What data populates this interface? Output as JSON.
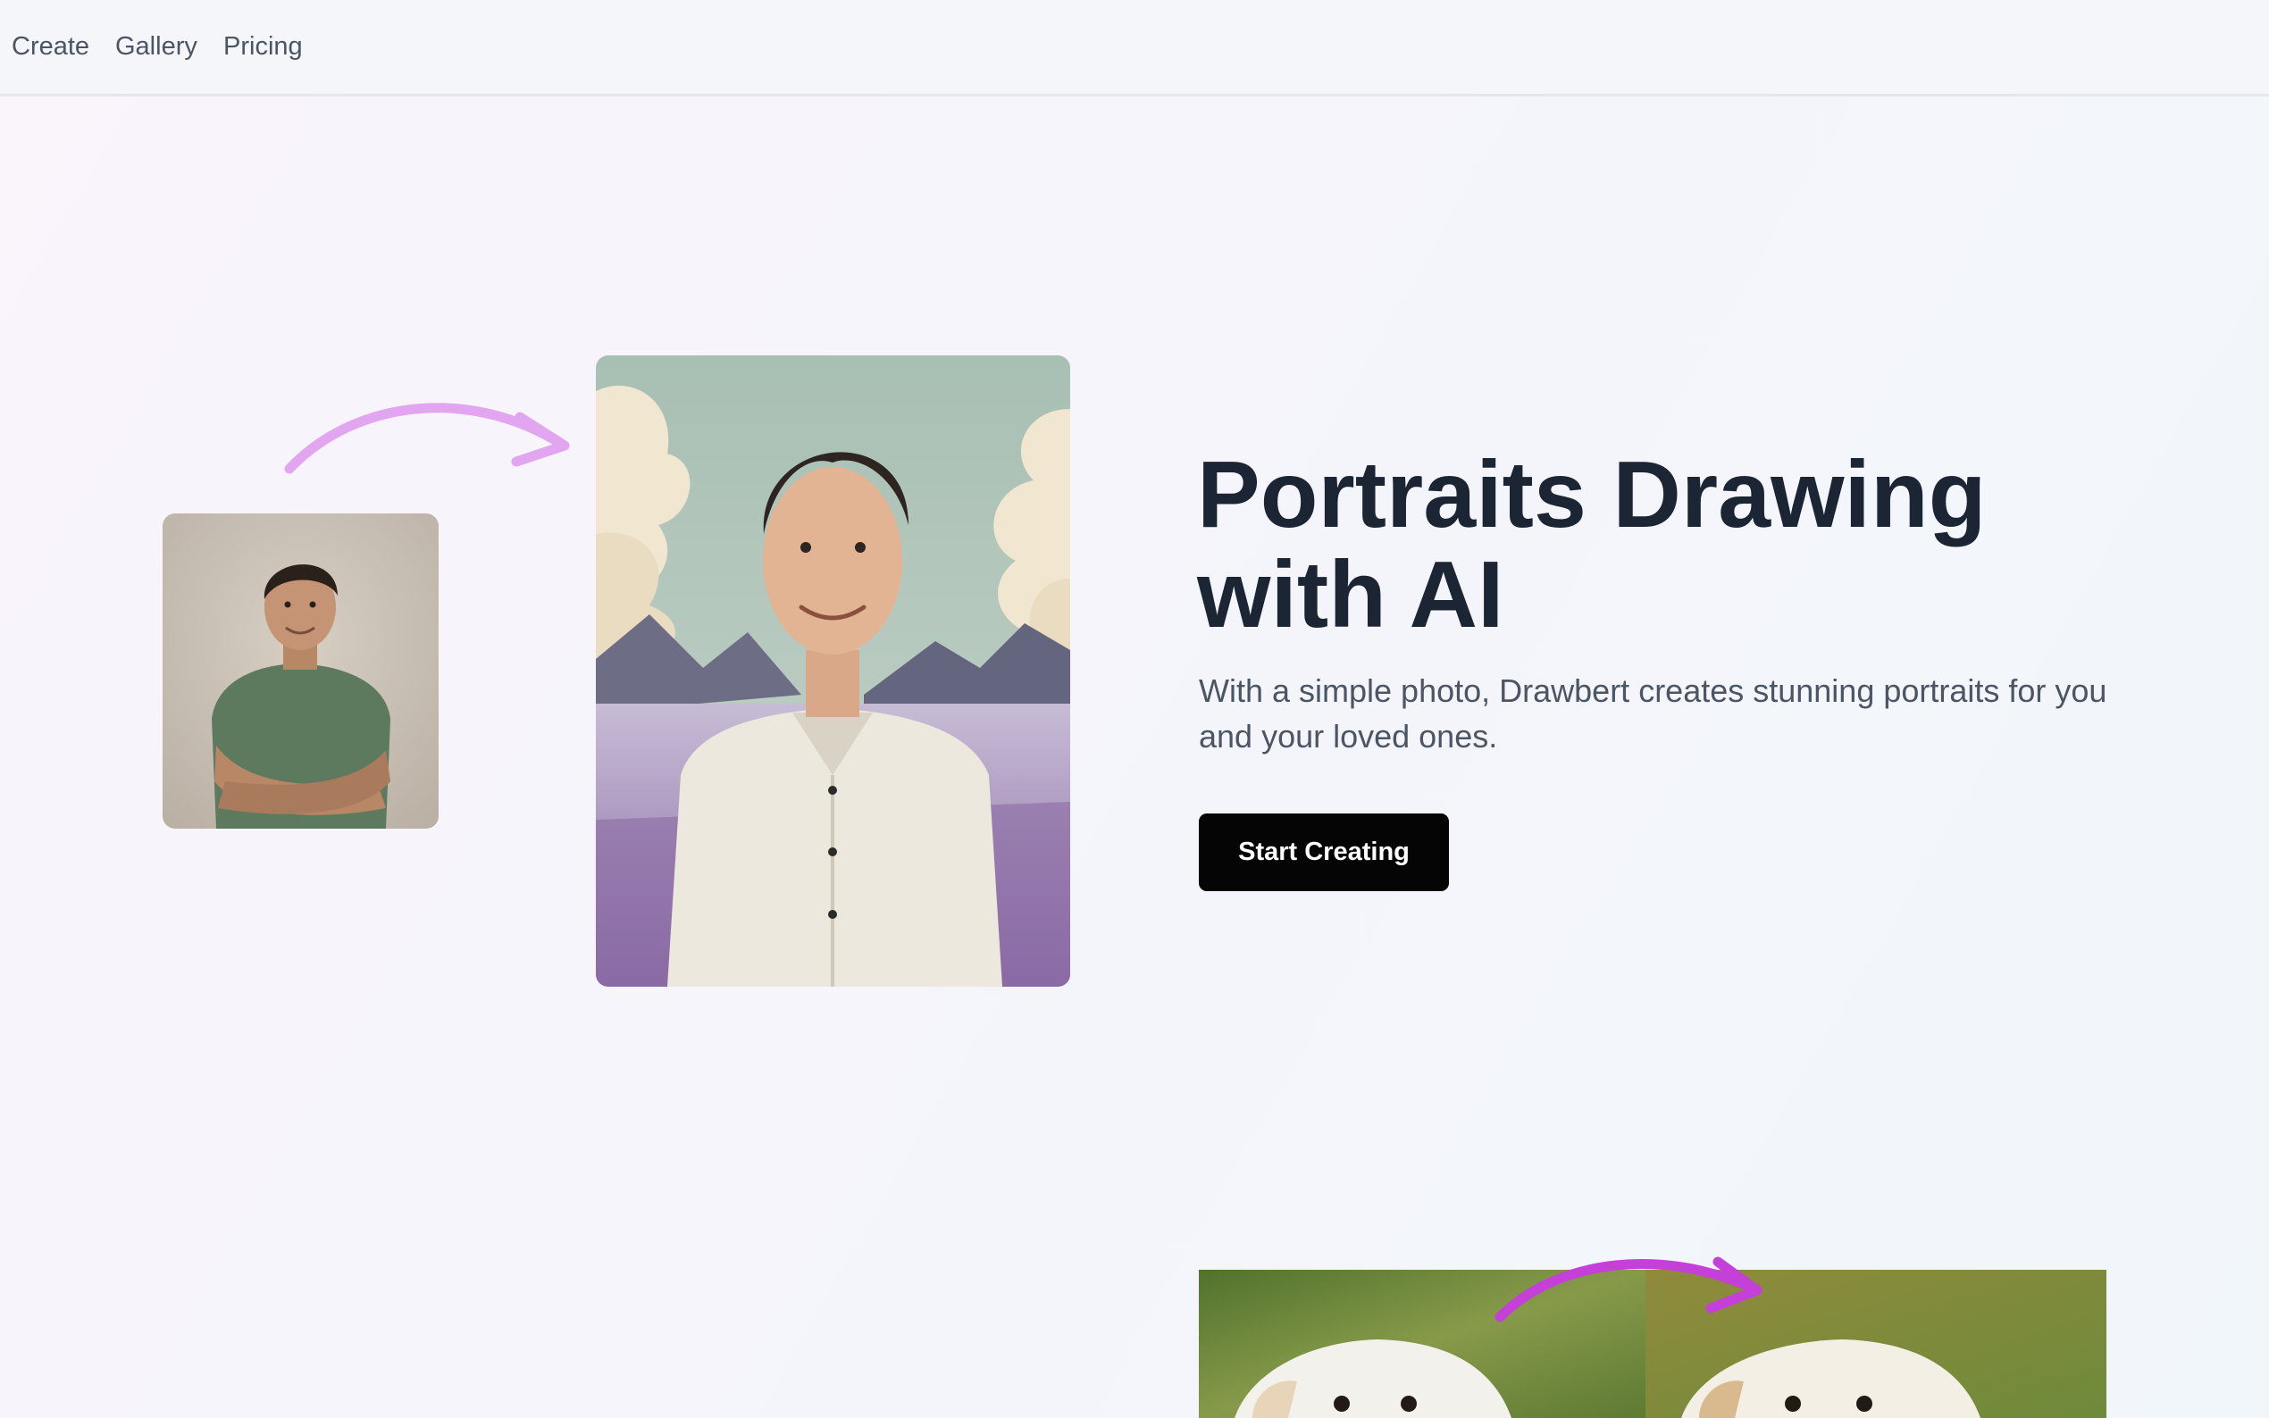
{
  "nav": {
    "items": [
      {
        "label": "Create"
      },
      {
        "label": "Gallery"
      },
      {
        "label": "Pricing"
      }
    ]
  },
  "hero": {
    "title": "Portraits Drawing with AI",
    "subtitle": "With a simple photo, Drawbert creates stunning portraits for you and your loved ones.",
    "cta_label": "Start Creating"
  },
  "colors": {
    "arrow_light": "#e2a5ef",
    "arrow_strong": "#c53fd9",
    "title": "#1c2533",
    "cta_bg": "#050505"
  },
  "icons": [
    "transform-arrow-icon"
  ]
}
